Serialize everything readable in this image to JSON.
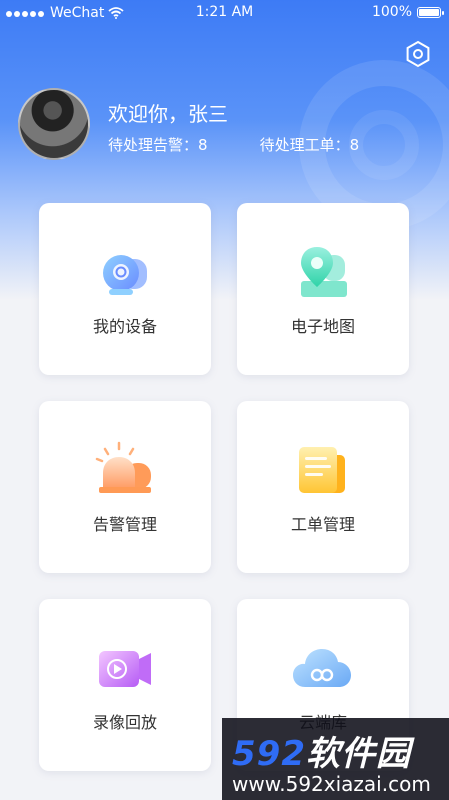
{
  "status_bar": {
    "carrier": "WeChat",
    "time": "1:21 AM",
    "battery": "100%"
  },
  "profile": {
    "greeting": "欢迎你，张三",
    "pending_alarms_label": "待处理告警：",
    "pending_alarms_count": "8",
    "pending_orders_label": "待处理工单：",
    "pending_orders_count": "8"
  },
  "menu": [
    {
      "label": "我的设备",
      "icon": "camera-icon"
    },
    {
      "label": "电子地图",
      "icon": "map-pin-icon"
    },
    {
      "label": "告警管理",
      "icon": "alarm-siren-icon"
    },
    {
      "label": "工单管理",
      "icon": "document-icon"
    },
    {
      "label": "录像回放",
      "icon": "video-playback-icon"
    },
    {
      "label": "云端库",
      "icon": "cloud-icon"
    }
  ],
  "watermark": {
    "brand": "592",
    "brand_cn": "软件园",
    "url": "www.592xiazai.com"
  }
}
